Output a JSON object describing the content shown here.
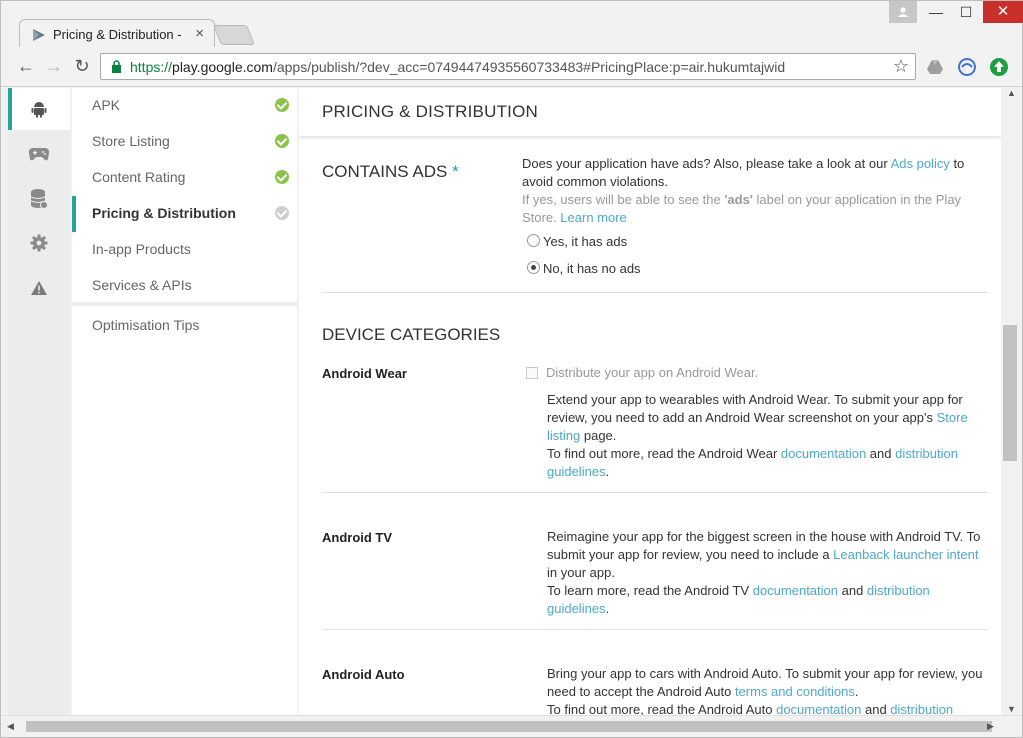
{
  "browser": {
    "tab_title": "Pricing & Distribution - H",
    "url_scheme": "https://",
    "url_host": "play.google.com",
    "url_path": "/apps/publish/?dev_acc=07494474935560733483#PricingPlace:p=air.hukumtajwid"
  },
  "sidebar": {
    "items": [
      {
        "label": "APK",
        "status": "complete"
      },
      {
        "label": "Store Listing",
        "status": "complete"
      },
      {
        "label": "Content Rating",
        "status": "complete"
      },
      {
        "label": "Pricing & Distribution",
        "status": "pending"
      },
      {
        "label": "In-app Products"
      },
      {
        "label": "Services & APIs"
      }
    ],
    "tips": "Optimisation Tips"
  },
  "page": {
    "title": "PRICING & DISTRIBUTION",
    "contains_ads": {
      "heading": "CONTAINS ADS",
      "required_mark": "*",
      "q1": "Does your application have ads? Also, please take a look at our ",
      "policy_link": "Ads policy",
      "q2": " to",
      "q3": "avoid common violations.",
      "hint1": "If yes, users will be able to see the ",
      "hint_bold": "'ads'",
      "hint2": " label on your application in the Play",
      "hint3": "Store. ",
      "learn_more": "Learn more",
      "option_yes": "Yes, it has ads",
      "option_no": "No, it has no ads",
      "selected": "no"
    },
    "device_categories": {
      "heading": "DEVICE CATEGORIES",
      "wear": {
        "label": "Android Wear",
        "checkbox": "Distribute your app on Android Wear.",
        "l1": "Extend your app to wearables with Android Wear. To submit your app for",
        "l2a": "review, you need to add an Android Wear screenshot on your app's ",
        "l2_link": "Store",
        "l3_link": "listing",
        "l3b": " page.",
        "l4a": "To find out more, read the Android Wear ",
        "l4_link1": "documentation",
        "l4_and": " and ",
        "l4_link2": "distribution",
        "l5_link": "guidelines",
        "l5b": "."
      },
      "tv": {
        "label": "Android TV",
        "l1": "Reimagine your app for the biggest screen in the house with Android TV. To",
        "l2a": "submit your app for review, you need to include a ",
        "l2_link": "Leanback launcher intent",
        "l3": "in your app.",
        "l4a": "To learn more, read the Android TV ",
        "l4_link1": "documentation",
        "l4_and": " and ",
        "l4_link2": "distribution",
        "l5_link": "guidelines",
        "l5b": "."
      },
      "auto": {
        "label": "Android Auto",
        "l1": "Bring your app to cars with Android Auto. To submit your app for review, you",
        "l2a": "need to accept the Android Auto ",
        "l2_link": "terms and conditions",
        "l2b": ".",
        "l3a": "To find out more, read the Android Auto ",
        "l3_link1": "documentation",
        "l3_and": " and ",
        "l3_link2": "distribution"
      }
    }
  },
  "colors": {
    "accent": "#26a69a",
    "link": "#4fa8c7",
    "check_green": "#8bc34a"
  }
}
